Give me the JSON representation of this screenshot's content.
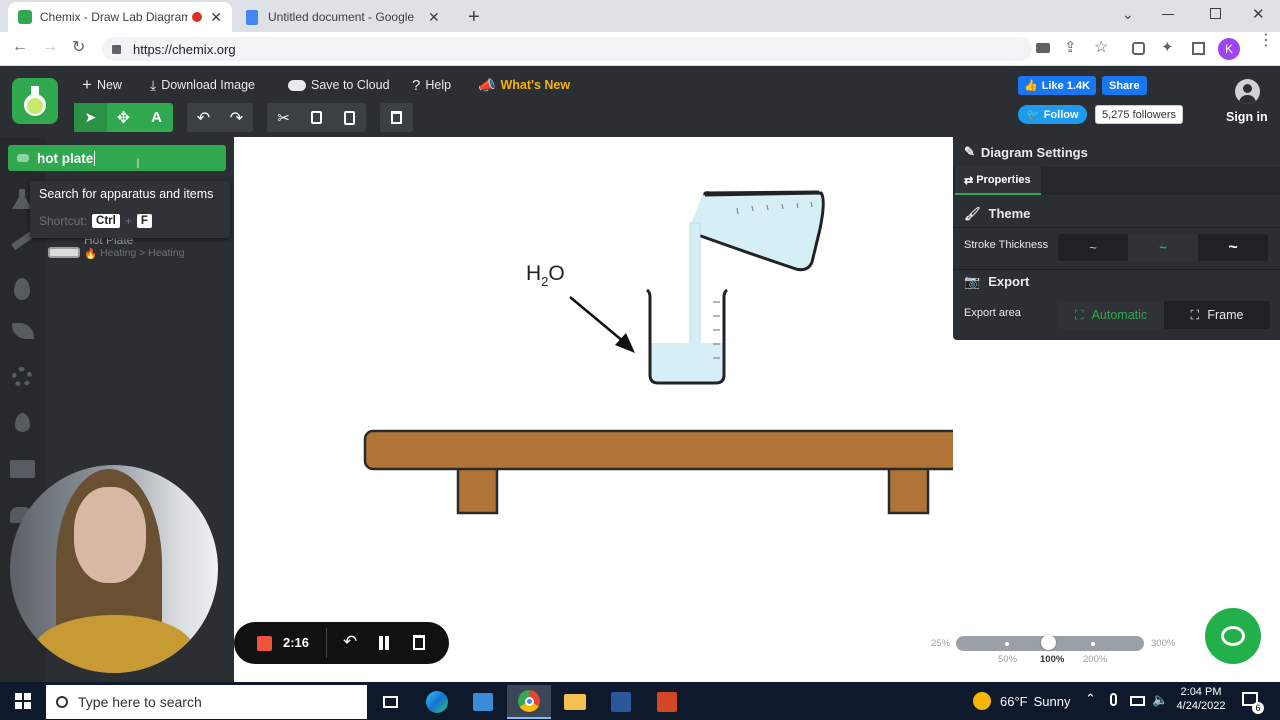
{
  "browser": {
    "tabs": [
      {
        "title": "Chemix - Draw Lab Diagram",
        "active": true
      },
      {
        "title": "Untitled document - Google Doc",
        "active": false
      }
    ],
    "url": "https://chemix.org",
    "profile_initial": "K"
  },
  "toolbar": {
    "new_label": "New",
    "download_label": "Download Image",
    "save_cloud_label": "Save to Cloud",
    "help_label": "Help",
    "whats_new_label": "What's New"
  },
  "social": {
    "like_label": "Like 1.4K",
    "share_label": "Share",
    "follow_label": "Follow",
    "followers": "5,275 followers",
    "signin_label": "Sign in"
  },
  "sidebar": {
    "search_value": "hot plate",
    "tooltip_title": "Search for apparatus and items",
    "tooltip_shortcut_label": "Shortcut:",
    "tooltip_key1": "Ctrl",
    "tooltip_plus": "+",
    "tooltip_key2": "F",
    "result_name": "Hot Plate",
    "result_path": "Heating > Heating"
  },
  "settings": {
    "title": "Diagram Settings",
    "properties_tab": "Properties",
    "theme_label": "Theme",
    "stroke_label": "Stroke Thickness",
    "export_label": "Export",
    "export_area_label": "Export area",
    "export_automatic": "Automatic",
    "export_frame": "Frame"
  },
  "canvas": {
    "label_h": "H",
    "label_sub": "2",
    "label_o": "O"
  },
  "recorder": {
    "time": "2:16"
  },
  "zoom": {
    "min": "25%",
    "max": "300%",
    "t1": "50%",
    "t2": "100%",
    "t3": "200%",
    "value_fraction": 0.33
  },
  "taskbar": {
    "search_placeholder": "Type here to search",
    "weather_temp": "66°F",
    "weather_desc": "Sunny",
    "time": "2:04 PM",
    "date": "4/24/2022",
    "notif_count": "6"
  },
  "colors": {
    "accent_green": "#2fa84f",
    "bench_brown": "#b07436",
    "water_blue": "#cfe9f2",
    "whats_new_yellow": "#f5b400",
    "fb_blue": "#1877f2",
    "twitter_blue": "#1d9bf0"
  }
}
